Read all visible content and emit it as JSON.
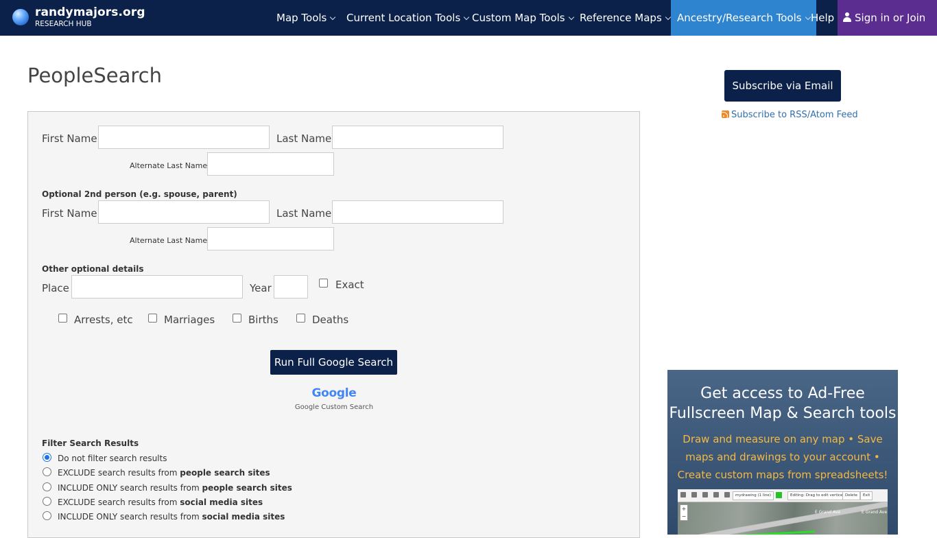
{
  "brand": {
    "name": "randymajors.org",
    "subtitle": "RESEARCH HUB"
  },
  "nav": {
    "items": [
      {
        "label": "Map Tools"
      },
      {
        "label": "Current Location Tools"
      },
      {
        "label": "Custom Map Tools"
      },
      {
        "label": "Reference Maps"
      },
      {
        "label": "Ancestry/Research Tools"
      }
    ],
    "help": "Help",
    "signin": "Sign in or Join"
  },
  "page": {
    "title": "PeopleSearch"
  },
  "form": {
    "person1": {
      "first_name_label": "First Name",
      "last_name_label": "Last Name",
      "alt_last_name_label": "Alternate Last Name",
      "first_name_value": "",
      "last_name_value": "",
      "alt_last_name_value": ""
    },
    "person2": {
      "section_label": "Optional 2nd person (e.g. spouse, parent)",
      "first_name_label": "First Name",
      "last_name_label": "Last Name",
      "alt_last_name_label": "Alternate Last Name",
      "first_name_value": "",
      "last_name_value": "",
      "alt_last_name_value": ""
    },
    "details": {
      "section_label": "Other optional details",
      "place_label": "Place",
      "place_value": "",
      "year_label": "Year",
      "year_value": "",
      "exact_label": "Exact",
      "exact_checked": false,
      "checkboxes": [
        {
          "label": "Arrests, etc",
          "checked": false
        },
        {
          "label": "Marriages",
          "checked": false
        },
        {
          "label": "Births",
          "checked": false
        },
        {
          "label": "Deaths",
          "checked": false
        }
      ]
    },
    "run_button": "Run Full Google Search",
    "google_logo": "Google",
    "google_caption": "Google Custom Search",
    "filter": {
      "section_label": "Filter Search Results",
      "selected_index": 0,
      "options": [
        {
          "prefix": "Do not filter search results",
          "bold": ""
        },
        {
          "prefix": "EXCLUDE search results from ",
          "bold": "people search sites"
        },
        {
          "prefix": "INCLUDE ONLY search results from ",
          "bold": "people search sites"
        },
        {
          "prefix": "EXCLUDE search results from ",
          "bold": "social media sites"
        },
        {
          "prefix": "INCLUDE ONLY search results from ",
          "bold": "social media sites"
        }
      ]
    }
  },
  "sidebar": {
    "subscribe_button": "Subscribe via Email",
    "rss_link": "Subscribe to RSS/Atom Feed",
    "promo": {
      "title_line1": "Get access to Ad-Free",
      "title_line2": "Fullscreen Map & Search tools",
      "subtitle": "Draw and measure on any map • Save maps and drawings to your account • Create custom maps from spreadsheets!",
      "shot_drawing_name": "mydrawing",
      "shot_drawing_count": "(1 line)",
      "shot_edit_hint": "Editing: Drag to edit vertices",
      "shot_delete": "Delete",
      "shot_exit": "Exit",
      "shot_road1": "E Grand Ave",
      "shot_road2": "E Grand Ave",
      "shot_zoom_in": "+",
      "shot_zoom_out": "−"
    }
  },
  "colors": {
    "navbar": "#0b2149",
    "nav_active": "#2f84cf",
    "nav_signin": "#5b2d90",
    "button": "#0b2149",
    "link": "#2f6fb3",
    "promo_accent": "#f5b942"
  }
}
